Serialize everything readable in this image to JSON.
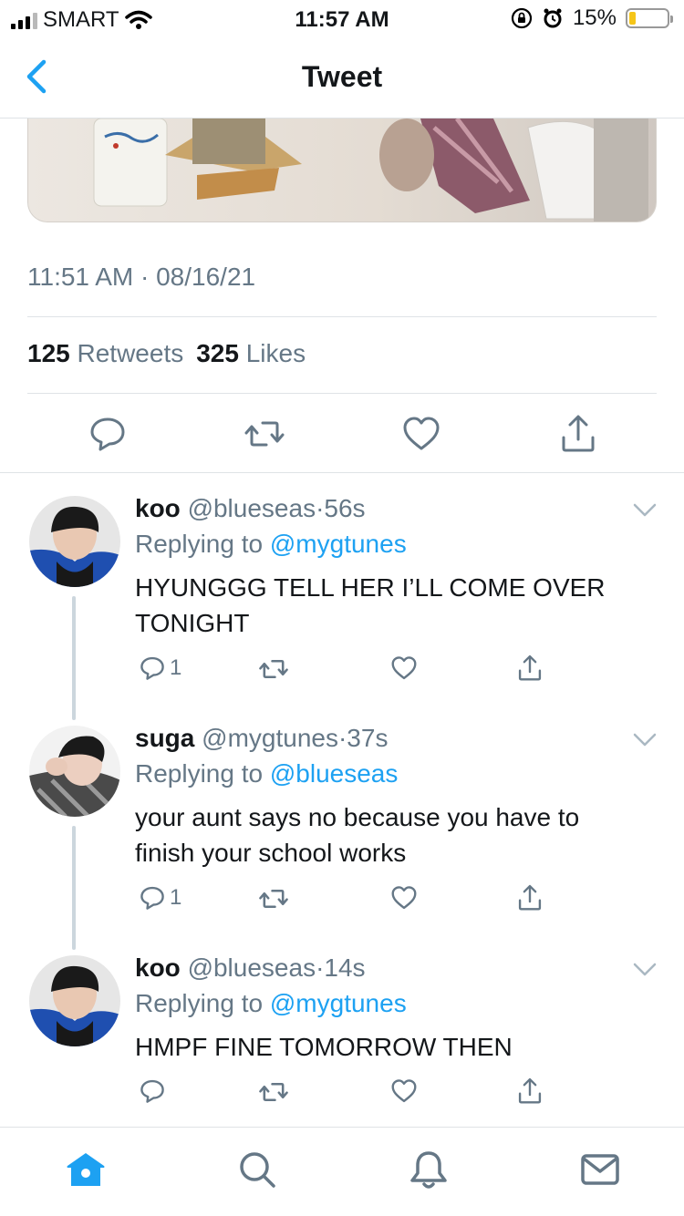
{
  "status_bar": {
    "carrier": "SMART",
    "time": "11:57 AM",
    "battery_pct": "15%",
    "battery_level": 0.15
  },
  "nav": {
    "title": "Tweet",
    "back_icon": "chevron-left-icon"
  },
  "tweet": {
    "timestamp": "11:51 AM · 08/16/21",
    "retweet_count": "125",
    "retweet_label": "Retweets",
    "like_count": "325",
    "like_label": "Likes"
  },
  "replies": [
    {
      "name": "koo",
      "handle": "@blueseas",
      "dot": "·",
      "time": "56s",
      "replying_label": "Replying to",
      "replying_to": "@mygtunes",
      "text": "HYUNGGG TELL HER I’LL COME OVER TONIGHT",
      "reply_count": "1"
    },
    {
      "name": "suga",
      "handle": "@mygtunes",
      "dot": "·",
      "time": "37s",
      "replying_label": "Replying to",
      "replying_to": "@blueseas",
      "text": "your aunt says no because you have to finish your school works",
      "reply_count": "1"
    },
    {
      "name": "koo",
      "handle": "@blueseas",
      "dot": "·",
      "time": "14s",
      "replying_label": "Replying to",
      "replying_to": "@mygtunes",
      "text": "HMPF FINE TOMORROW THEN",
      "reply_count": ""
    }
  ],
  "tabbar": {
    "active_tab": "home",
    "accent_color": "#1da1f2",
    "icons": [
      "home-icon",
      "search-icon",
      "notifications-icon",
      "messages-icon"
    ]
  }
}
